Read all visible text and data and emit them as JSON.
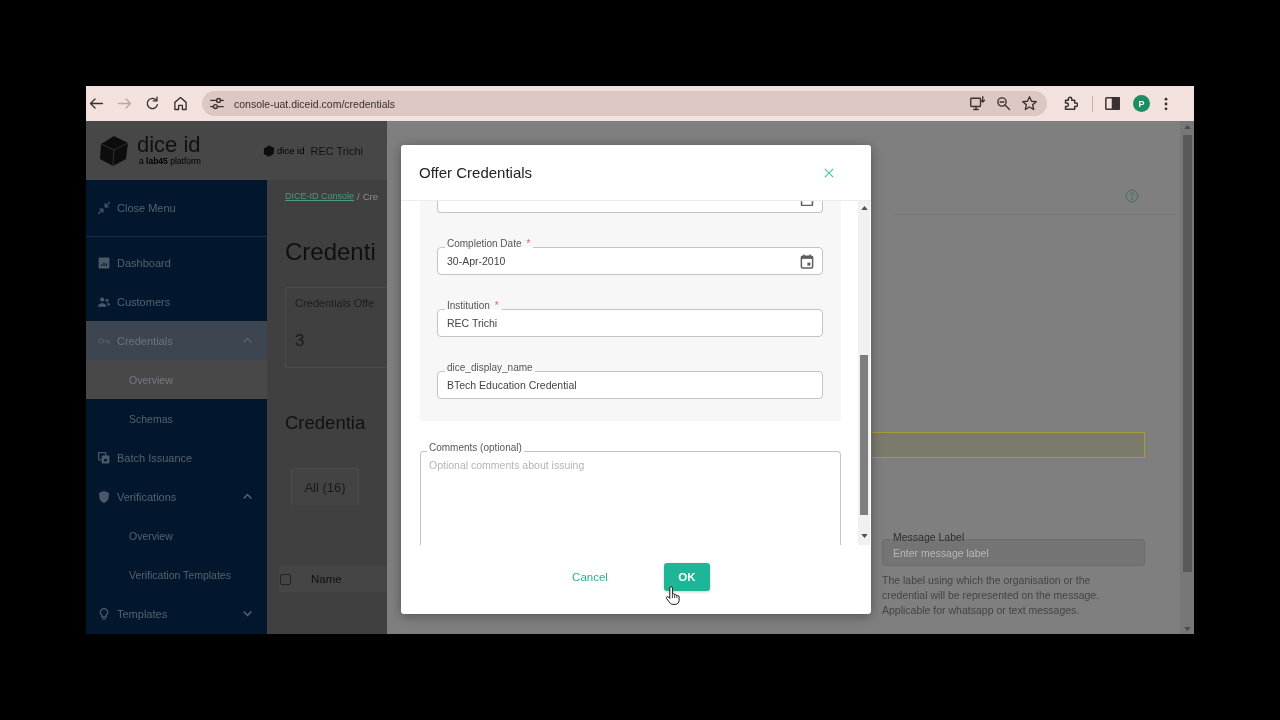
{
  "browser": {
    "nav": [
      {
        "kind": "back",
        "disabled": false
      },
      {
        "kind": "forward",
        "disabled": true
      },
      {
        "kind": "reload",
        "disabled": false
      },
      {
        "kind": "home",
        "disabled": false
      }
    ],
    "url": "console-uat.diceid.com/credentials",
    "profile_initial": "P"
  },
  "header": {
    "logo": {
      "name": "dice id",
      "tagline": "a **lab45** platform"
    },
    "org": {
      "logo_text": "dice id",
      "name": "REC Trichi"
    }
  },
  "sidebar": {
    "close_menu": "Close Menu",
    "items": [
      {
        "kind": "dashboard",
        "label": "Dashboard",
        "selected": false
      },
      {
        "kind": "customers",
        "label": "Customers",
        "selected": false
      },
      {
        "kind": "credentials",
        "label": "Credentials",
        "selected": true,
        "expanded": true,
        "children": [
          {
            "label": "Overview",
            "selected": true
          },
          {
            "label": "Schemas",
            "selected": false
          }
        ]
      },
      {
        "kind": "batch",
        "label": "Batch Issuance",
        "selected": false
      },
      {
        "kind": "verifications",
        "label": "Verifications",
        "selected": false,
        "expanded": true,
        "children": [
          {
            "label": "Overview",
            "selected": false
          },
          {
            "label": "Verification Templates",
            "selected": false
          }
        ]
      },
      {
        "kind": "templates",
        "label": "Templates",
        "selected": false,
        "expanded": false
      }
    ]
  },
  "main": {
    "breadcrumb": {
      "link": "DICE-ID Console",
      "separator": "/",
      "current": "Cre"
    },
    "title": "Credenti",
    "stat_card": {
      "label": "Credentials Offe",
      "value": "3"
    },
    "section_title": "Credentia",
    "tabs": [
      {
        "label": "All (16)",
        "selected": true
      }
    ],
    "table": {
      "select_all": {
        "checked": false
      },
      "columns": [
        "Name"
      ]
    }
  },
  "side_panel": {
    "message_label": {
      "label": "Message Label",
      "placeholder": "Enter message label",
      "help": "The label using which the organisation or the credential will be represented on the message. Applicable for whatsapp or text messages."
    }
  },
  "modal": {
    "title": "Offer Credentials",
    "scrolled_field": {
      "kind": "date"
    },
    "fields": [
      {
        "kind": "date",
        "label": "Completion Date",
        "required_mark": "*",
        "value": "30-Apr-2010"
      },
      {
        "kind": "text",
        "label": "Institution",
        "required_mark": "*",
        "value": "REC Trichi"
      },
      {
        "kind": "text",
        "label": "dice_display_name",
        "value": "BTech Education Credential"
      }
    ],
    "comments": {
      "label": "Comments (optional)",
      "placeholder": "Optional comments about issuing"
    },
    "buttons": [
      {
        "kind": "cancel",
        "label": "Cancel"
      },
      {
        "kind": "confirm",
        "label": "OK"
      }
    ]
  }
}
